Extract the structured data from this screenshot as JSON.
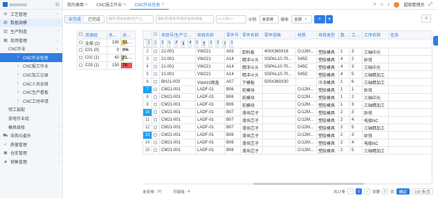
{
  "topbar": {
    "tabs": [
      {
        "label": "我的桌面",
        "active": false
      },
      {
        "label": "CNC报工作业",
        "active": false
      },
      {
        "label": "CNC作业任务",
        "active": true
      }
    ],
    "username": "超级管理员"
  },
  "sidebar": {
    "items": [
      {
        "label": "工艺管理",
        "icon": "gear-icon",
        "level": 1,
        "arrow": "⌄",
        "state": ""
      },
      {
        "label": "数据调模",
        "icon": "db-icon",
        "level": 1,
        "arrow": "›",
        "state": "hl"
      },
      {
        "label": "生产制造",
        "icon": "factory-icon",
        "level": 1,
        "arrow": "›",
        "state": ""
      },
      {
        "label": "现场管理",
        "icon": "site-icon",
        "level": 1,
        "arrow": "⌄",
        "state": ""
      },
      {
        "label": "CNC作业",
        "icon": "",
        "level": 2,
        "arrow": "⌄",
        "state": ""
      },
      {
        "label": "CNC作业任务",
        "icon": "",
        "level": 3,
        "arrow": "",
        "state": "active"
      },
      {
        "label": "CNC报工作业",
        "icon": "",
        "level": 3,
        "arrow": "",
        "state": ""
      },
      {
        "label": "CNC加工记录",
        "icon": "",
        "level": 3,
        "arrow": "",
        "state": ""
      },
      {
        "label": "CNC人员安排",
        "icon": "",
        "level": 3,
        "arrow": "",
        "state": ""
      },
      {
        "label": "CNC生产看板",
        "icon": "",
        "level": 3,
        "arrow": "",
        "state": ""
      },
      {
        "label": "CNC工时申请",
        "icon": "",
        "level": 3,
        "arrow": "",
        "state": ""
      },
      {
        "label": "钳工装配",
        "icon": "",
        "level": 2,
        "arrow": "›",
        "state": ""
      },
      {
        "label": "放电作业组",
        "icon": "",
        "level": 2,
        "arrow": "›",
        "state": ""
      },
      {
        "label": "模具维修",
        "icon": "",
        "level": 2,
        "arrow": "›",
        "state": ""
      },
      {
        "label": "采购与委外",
        "icon": "cart-icon",
        "level": 1,
        "arrow": "›",
        "state": ""
      },
      {
        "label": "质量管理",
        "icon": "check-icon",
        "level": 1,
        "arrow": "›",
        "state": ""
      },
      {
        "label": "仓库管理",
        "icon": "warehouse-icon",
        "level": 1,
        "arrow": "›",
        "state": ""
      },
      {
        "label": "销售管理",
        "icon": "sales-icon",
        "level": 1,
        "arrow": "›",
        "state": ""
      }
    ]
  },
  "filter": {
    "seg_unfinished": "未完成",
    "seg_finished": "已完成",
    "search_placeholder_1": "模号/项目名称/生产订...",
    "search_placeholder_2": "模料号/零件号/零件名称/规格",
    "date_placeholder": "<<工序>>",
    "plan_label": "计划:",
    "plan_value": "未安排",
    "receive_label": "接收:",
    "receive_value": "全部"
  },
  "left_table": {
    "headers": [
      "",
      "资源组",
      "总工时",
      "总工时比"
    ],
    "rows": [
      {
        "group": "全部 (2)",
        "hours": "190",
        "ratio": "33.3%",
        "pct": 33.3,
        "color": "#f5d76e"
      },
      {
        "group": "C01 (0)",
        "hours": "0",
        "ratio": "0%",
        "pct": 0,
        "color": "#f5d76e"
      },
      {
        "group": "C02 (1)",
        "hours": "40",
        "ratio": "21.1%",
        "pct": 21.1,
        "color": "#8fd16b"
      },
      {
        "group": "C03 (1)",
        "hours": "150",
        "ratio": "78.9%",
        "pct": 78.9,
        "color": "#ef5350"
      }
    ]
  },
  "right_table": {
    "headers": [
      "",
      "",
      "项目号/生产订单号",
      "项目名称",
      "零件号",
      "零件名称",
      "零件规格",
      "材质",
      "项目类型",
      "数量",
      "工序号",
      "工序名称",
      "任务"
    ],
    "rows": [
      {
        "idx": "1",
        "mark": false,
        "sel": true,
        "cells": [
          "21-001",
          "VW221",
          "A03",
          "卸料板",
          "400X360X18",
          "Cr12MoV",
          "塑胶模具",
          "1",
          "2",
          "开粗",
          "1.0"
        ]
      },
      {
        "idx": "2",
        "mark": false,
        "sel": false,
        "cells": [
          "21-001",
          "VW221",
          "A03",
          "卸料板",
          "400X360X18",
          "Cr12MoV",
          "塑胶模具",
          "1",
          "3",
          "三轴中光",
          ""
        ]
      },
      {
        "idx": "3",
        "mark": false,
        "sel": false,
        "cells": [
          "21-001",
          "VW221",
          "A14",
          "精冲斗头",
          "SSPAL10-70...",
          "S45C",
          "塑胶模具",
          "4",
          "2",
          "卧铣",
          ""
        ]
      },
      {
        "idx": "4",
        "mark": false,
        "sel": false,
        "cells": [
          "21-001",
          "VW221",
          "A14",
          "精冲斗头",
          "SSPAL10-70...",
          "S45C",
          "塑胶模具",
          "4",
          "3",
          "三轴中光",
          ""
        ]
      },
      {
        "idx": "5",
        "mark": false,
        "sel": false,
        "cells": [
          "21-001",
          "VW221",
          "A14",
          "精冲斗头",
          "SSPAL10-70...",
          "S45C",
          "塑胶模具",
          "4",
          "5",
          "三轴精加工",
          ""
        ]
      },
      {
        "idx": "6",
        "mark": false,
        "sel": false,
        "cells": [
          "BH21-003",
          "VW433两盖",
          "A07",
          "下模板",
          "500X360X30",
          "",
          "冷冲模具",
          "1",
          "6",
          "三轴精加工",
          ""
        ]
      },
      {
        "idx": "7",
        "mark": true,
        "sel": false,
        "cells": [
          "CM21-001",
          "LADF-01",
          "B06",
          "前模块",
          "",
          "Cr12MoV",
          "塑胶模具",
          "1",
          "1",
          "卧铣",
          ""
        ]
      },
      {
        "idx": "8",
        "mark": false,
        "sel": false,
        "cells": [
          "CM21-001",
          "LADF-01",
          "B06",
          "前模块",
          "",
          "Cr12MoV",
          "塑胶模具",
          "1",
          "2",
          "三轴中光",
          ""
        ]
      },
      {
        "idx": "9",
        "mark": false,
        "sel": false,
        "cells": [
          "CM21-001",
          "LADF-01",
          "B06",
          "前模块",
          "",
          "Cr12MoV",
          "塑胶模具",
          "1",
          "3",
          "三轴精加工",
          ""
        ]
      },
      {
        "idx": "10",
        "mark": true,
        "sel": false,
        "cells": [
          "CM21-001",
          "LADF-01",
          "B07",
          "滑块芯子",
          "",
          "Cr12MoV",
          "塑胶模具",
          "2",
          "3",
          "卧铣",
          ""
        ]
      },
      {
        "idx": "11",
        "mark": false,
        "sel": false,
        "cells": [
          "CM21-001",
          "LADF-01",
          "B07",
          "滑块芯子",
          "",
          "Cr12MoV",
          "塑胶模具",
          "2",
          "4",
          "电极NC",
          ""
        ]
      },
      {
        "idx": "12",
        "mark": false,
        "sel": false,
        "cells": [
          "CM21-001",
          "LADF-01",
          "B07",
          "滑块芯子",
          "",
          "Cr12MoV",
          "塑胶模具",
          "2",
          "5",
          "三轴精加工",
          ""
        ]
      },
      {
        "idx": "13",
        "mark": true,
        "sel": false,
        "cells": [
          "CM21-001",
          "LADF-01",
          "B08",
          "滑块芯子",
          "",
          "Cr12MoV",
          "塑胶模具",
          "2",
          "3",
          "卧铣",
          ""
        ]
      },
      {
        "idx": "14",
        "mark": false,
        "sel": false,
        "cells": [
          "CM21-001",
          "LADF-01",
          "B08",
          "滑块芯子",
          "",
          "Cr12MoV",
          "塑胶模具",
          "2",
          "4",
          "电极NC",
          ""
        ]
      },
      {
        "idx": "15",
        "mark": false,
        "sel": false,
        "cells": [
          "CM21-001",
          "LADF-01",
          "B08",
          "滑块芯子",
          "",
          "Cr12MoV",
          "塑胶模具",
          "2",
          "5",
          "三轴精加工",
          ""
        ]
      }
    ]
  },
  "footer": {
    "unplanned_label": "未安排:",
    "unplanned_count": "20",
    "receivable_label": "可接收:",
    "receivable_count": "4",
    "total": "共17条",
    "pages": [
      "1",
      "2"
    ],
    "current_page": "1",
    "goto_label": "到第",
    "goto_value": "1",
    "page_unit": "页",
    "ok_label": "确定",
    "page_size": "100 条/页"
  }
}
